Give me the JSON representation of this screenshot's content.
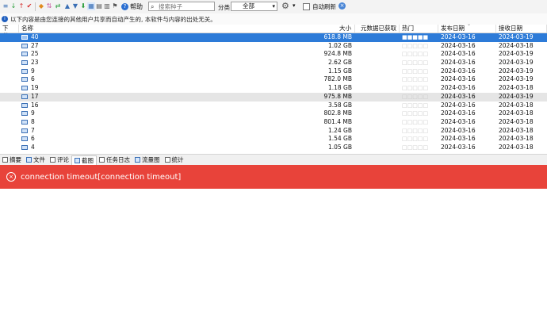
{
  "toolbar": {
    "icons": [
      "list-icon",
      "download-green-icon",
      "upload-red-icon",
      "checkmark-icon",
      "color-icon",
      "sort-icon",
      "up-arrow-icon",
      "down-arrow-icon",
      "document-icon",
      "document-icon",
      "filter-icon"
    ],
    "help_label": "帮助",
    "search_placeholder": "搜索种子",
    "category_label": "分类",
    "category_value": "全部",
    "auto_refresh_label": "自动刷新"
  },
  "notice": {
    "text": "以下内容是由您连接的其他用户共享而自动产生的, 本软件与内容的出处无关。"
  },
  "table": {
    "headers": {
      "download": "下载...",
      "name": "名称",
      "size": "大小",
      "meta": "元数据已获取",
      "hot": "热门",
      "published": "发布日期",
      "received": "接收日期"
    },
    "rows": [
      {
        "name": "40",
        "size": "618.8 MB",
        "hot": "■■■■■",
        "published": "2024-03-16",
        "received": "2024-03-19"
      },
      {
        "name": "27",
        "size": "1.02 GB",
        "hot": "□□□□□",
        "published": "2024-03-16",
        "received": "2024-03-18"
      },
      {
        "name": "25",
        "size": "924.8 MB",
        "hot": "□□□□□",
        "published": "2024-03-16",
        "received": "2024-03-19"
      },
      {
        "name": "23",
        "size": "2.62 GB",
        "hot": "□□□□□",
        "published": "2024-03-16",
        "received": "2024-03-19"
      },
      {
        "name": "9",
        "size": "1.15 GB",
        "hot": "□□□□□",
        "published": "2024-03-16",
        "received": "2024-03-19"
      },
      {
        "name": "6",
        "size": "782.0 MB",
        "hot": "□□□□□",
        "published": "2024-03-16",
        "received": "2024-03-19"
      },
      {
        "name": "19",
        "size": "1.18 GB",
        "hot": "□□□□□",
        "published": "2024-03-16",
        "received": "2024-03-18"
      },
      {
        "name": "17",
        "size": "975.8 MB",
        "hot": "□□□□□",
        "published": "2024-03-16",
        "received": "2024-03-19"
      },
      {
        "name": "16",
        "size": "3.58 GB",
        "hot": "□□□□□",
        "published": "2024-03-16",
        "received": "2024-03-18"
      },
      {
        "name": "9",
        "size": "802.8 MB",
        "hot": "□□□□□",
        "published": "2024-03-16",
        "received": "2024-03-18"
      },
      {
        "name": "8",
        "size": "801.4 MB",
        "hot": "□□□□□",
        "published": "2024-03-16",
        "received": "2024-03-18"
      },
      {
        "name": "7",
        "size": "1.24 GB",
        "hot": "□□□□□",
        "published": "2024-03-16",
        "received": "2024-03-18"
      },
      {
        "name": "6",
        "size": "1.54 GB",
        "hot": "□□□□□",
        "published": "2024-03-16",
        "received": "2024-03-18"
      },
      {
        "name": "4",
        "size": "1.05 GB",
        "hot": "□□□□□",
        "published": "2024-03-16",
        "received": "2024-03-18"
      }
    ]
  },
  "tabs": [
    {
      "label": "摘要",
      "icon": "summary-icon"
    },
    {
      "label": "文件",
      "icon": "file-icon"
    },
    {
      "label": "评论",
      "icon": "comment-icon"
    },
    {
      "label": "截图",
      "icon": "screenshot-icon"
    },
    {
      "label": "任务日志",
      "icon": "log-icon"
    },
    {
      "label": "流量图",
      "icon": "chart-icon"
    },
    {
      "label": "统计",
      "icon": "stats-icon"
    }
  ],
  "error": {
    "message": "connection timeout[connection timeout]"
  },
  "colors": {
    "selection": "#2d7bd8",
    "error_bg": "#e8433a",
    "highlight_row": "#e5e5e5"
  }
}
